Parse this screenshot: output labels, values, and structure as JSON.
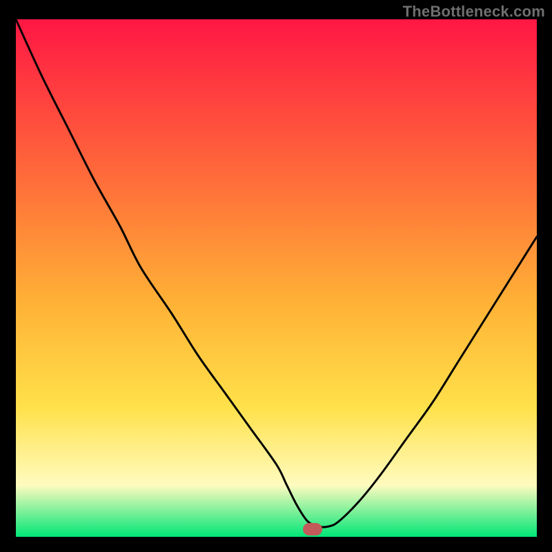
{
  "watermark": "TheBottleneck.com",
  "colors": {
    "frame": "#000000",
    "marker": "#c25a5a",
    "curve": "#000000",
    "watermark": "#6f6f6f",
    "gradient_top": "#ff1744",
    "gradient_mid1": "#ff6a3a",
    "gradient_mid2": "#ffb236",
    "gradient_mid3": "#ffe14a",
    "gradient_band": "#fffbbf",
    "gradient_bottom": "#00e676"
  },
  "chart_data": {
    "type": "line",
    "title": "",
    "xlabel": "",
    "ylabel": "",
    "xlim": [
      0,
      100
    ],
    "ylim": [
      0,
      100
    ],
    "x": [
      0,
      5,
      10,
      15,
      20,
      24,
      30,
      35,
      40,
      45,
      50,
      52,
      54,
      56,
      58,
      60,
      62,
      66,
      70,
      75,
      80,
      85,
      90,
      95,
      100
    ],
    "values": [
      100,
      89,
      79,
      69,
      60,
      52,
      43,
      35,
      28,
      21,
      14,
      10,
      6,
      3,
      2,
      2,
      3,
      7,
      12,
      19,
      26,
      34,
      42,
      50,
      58
    ],
    "flat_bottom_range": [
      54,
      60
    ],
    "marker": {
      "x": 57,
      "y": 1.5
    },
    "annotations": []
  }
}
